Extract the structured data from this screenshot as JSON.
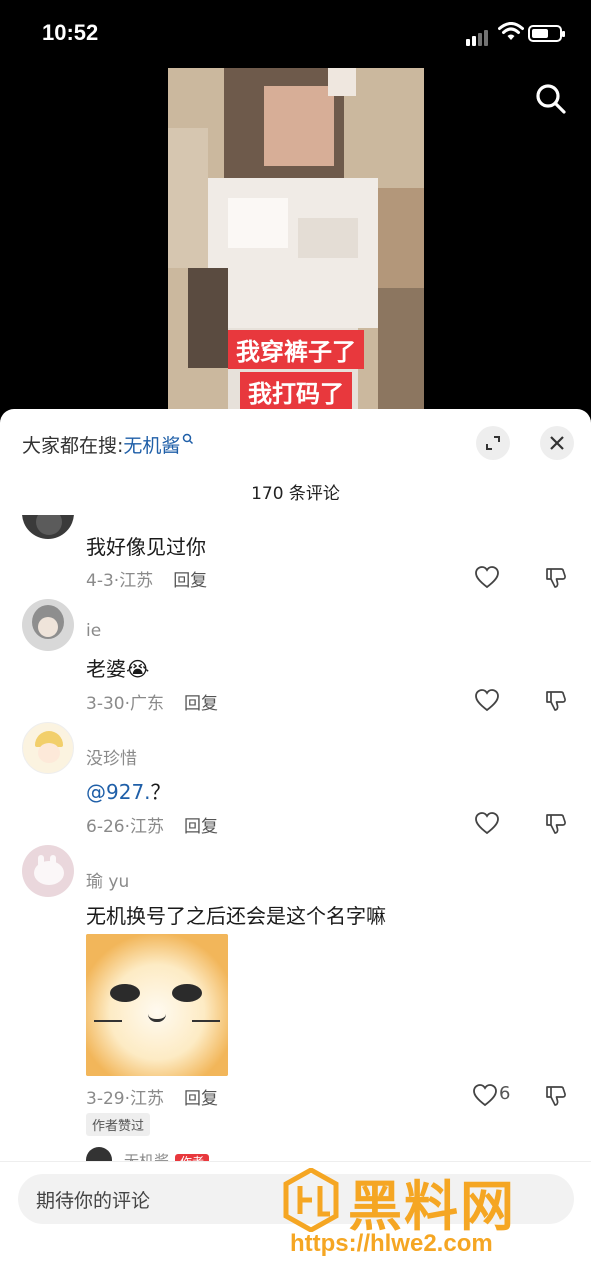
{
  "status_bar": {
    "time": "10:52"
  },
  "video": {
    "captions": [
      "我穿裤子了",
      "我打码了"
    ]
  },
  "sheet": {
    "hot_search_prefix": "大家都在搜:",
    "hot_search_keyword": "无机酱",
    "comment_count": "170 条评论"
  },
  "comments": [
    {
      "text": "我好像见过你",
      "date": "4-3",
      "location": "江苏",
      "reply": "回复"
    },
    {
      "username": "ie",
      "text": "老婆😭",
      "date": "3-30",
      "location": "广东",
      "reply": "回复"
    },
    {
      "username": "没珍惜",
      "mention": "@927.",
      "text": "？",
      "date": "6-26",
      "location": "江苏",
      "reply": "回复"
    },
    {
      "username": "瑜 yu",
      "text": "无机换号了之后还会是这个名字嘛",
      "date": "3-29",
      "location": "江苏",
      "reply": "回复",
      "likes": "6",
      "badge": "作者赞过"
    }
  ],
  "reply_peek": {
    "username": "无机酱",
    "tag": "作者"
  },
  "input": {
    "placeholder": "期待你的评论"
  },
  "watermark": {
    "brand": "黑料网",
    "url": "https://hlwe2.com"
  },
  "colors": {
    "accent_red": "#e8383d",
    "link_blue": "#1f5fa8",
    "watermark_orange": "#f5a623"
  }
}
